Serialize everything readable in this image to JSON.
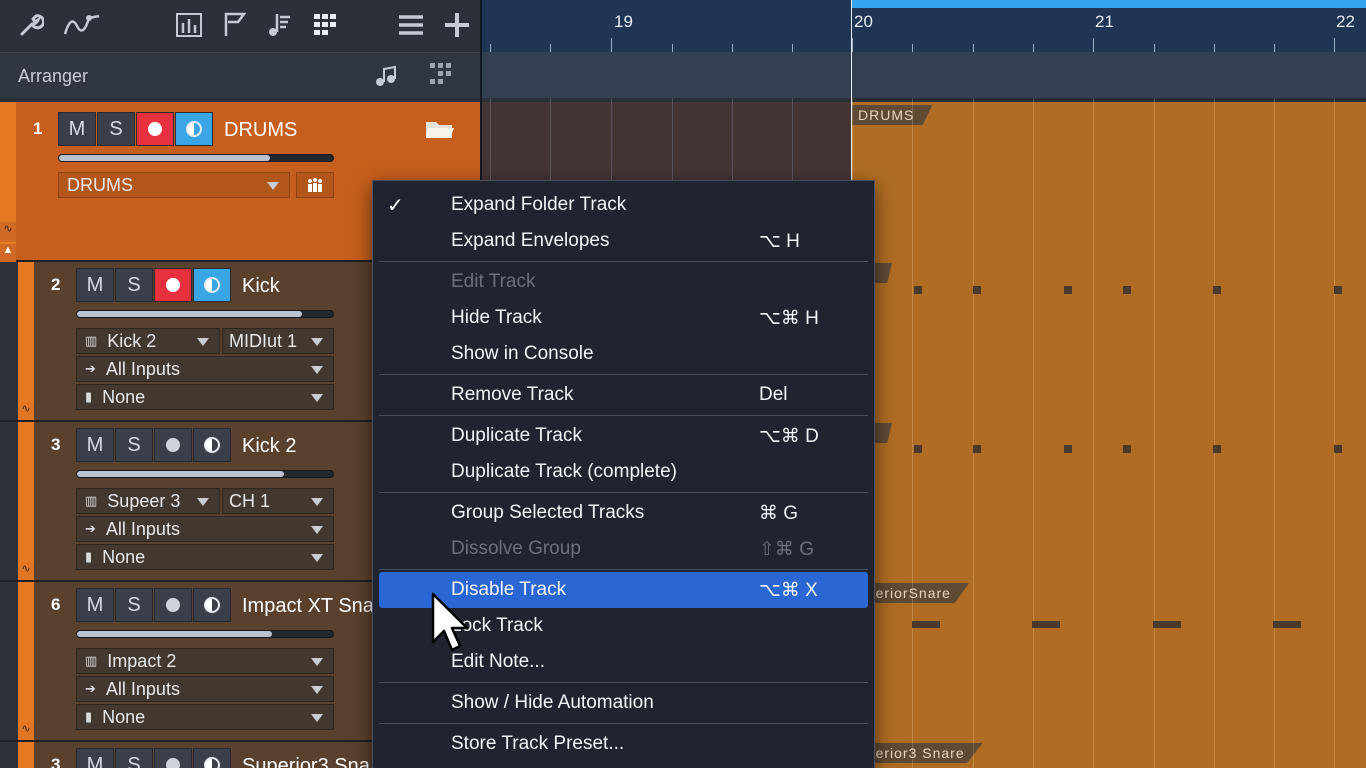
{
  "toolbar": {
    "icons": [
      "wrench-icon",
      "automation-curve-icon",
      "mixer-view-icon",
      "marker-flag-icon",
      "score-notes-icon",
      "grid-icon",
      "list-icon",
      "add-icon"
    ]
  },
  "arranger": {
    "title": "Arranger",
    "icons": [
      "music-note-icon",
      "grid-dots-icon"
    ]
  },
  "ruler": {
    "bars": [
      "19",
      "20",
      "21",
      "22"
    ],
    "accent": "#35a3ef"
  },
  "tracks": [
    {
      "num": "1",
      "mute": "M",
      "solo": "S",
      "name": "DRUMS",
      "select": "DRUMS",
      "type": "folder",
      "rec": true,
      "mon": true,
      "volume": 0.77
    },
    {
      "num": "2",
      "mute": "M",
      "solo": "S",
      "name": "Kick",
      "instrument": "Kick 2",
      "channel": "MIDIut 1",
      "input": "All Inputs",
      "output": "None",
      "type": "child",
      "rec": true,
      "mon": true,
      "volume": 0.88
    },
    {
      "num": "3",
      "mute": "M",
      "solo": "S",
      "name": "Kick 2",
      "instrument": "Supeer 3",
      "channel": "CH 1",
      "input": "All Inputs",
      "output": "None",
      "type": "child",
      "rec": false,
      "mon": false,
      "volume": 0.81
    },
    {
      "num": "6",
      "mute": "M",
      "solo": "S",
      "name": "Impact XT Sna",
      "instrument": "Impact 2",
      "channel": "",
      "input": "All Inputs",
      "output": "None",
      "type": "child",
      "rec": false,
      "mon": false,
      "volume": 0.76
    },
    {
      "num": "3",
      "mute": "M",
      "solo": "S",
      "name": "Superior3 Sna",
      "type": "child",
      "rec": false,
      "mon": false
    }
  ],
  "events": [
    "DRUMS",
    "ck",
    "ck",
    "uperiorSnare",
    "uperior3 Snare"
  ],
  "context_menu": {
    "items": [
      {
        "label": "Expand Folder Track",
        "shortcut": "",
        "checked": true
      },
      {
        "label": "Expand Envelopes",
        "shortcut": "⌥ H"
      },
      {
        "sep": true
      },
      {
        "label": "Edit Track",
        "shortcut": "",
        "disabled": true
      },
      {
        "label": "Hide Track",
        "shortcut": "⌥⌘ H"
      },
      {
        "label": "Show in Console",
        "shortcut": ""
      },
      {
        "sep": true
      },
      {
        "label": "Remove Track",
        "shortcut": "Del"
      },
      {
        "sep": true
      },
      {
        "label": "Duplicate Track",
        "shortcut": "⌥⌘ D"
      },
      {
        "label": "Duplicate Track (complete)",
        "shortcut": ""
      },
      {
        "sep": true
      },
      {
        "label": "Group Selected Tracks",
        "shortcut": "⌘ G"
      },
      {
        "label": "Dissolve Group",
        "shortcut": "⇧⌘ G",
        "disabled": true
      },
      {
        "sep": true
      },
      {
        "label": "Disable Track",
        "shortcut": "⌥⌘ X",
        "highlight": true
      },
      {
        "label": "Lock Track",
        "shortcut": ""
      },
      {
        "label": "Edit Note...",
        "shortcut": ""
      },
      {
        "sep": true
      },
      {
        "label": "Show / Hide Automation",
        "shortcut": ""
      },
      {
        "sep": true
      },
      {
        "label": "Store Track Preset...",
        "shortcut": ""
      }
    ]
  },
  "colors": {
    "folder": "#c65f1d",
    "event": "#b06c22",
    "highlight": "#2b67d4",
    "record": "#e8303f",
    "monitor": "#3aa6e6"
  }
}
